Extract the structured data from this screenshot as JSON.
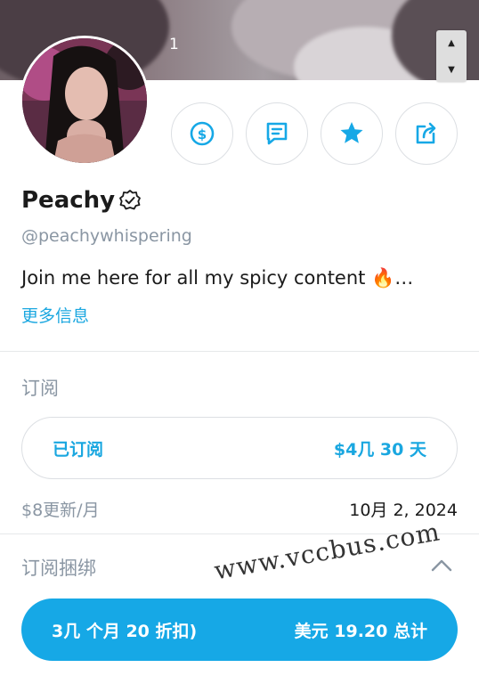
{
  "cover": {
    "counter": "1"
  },
  "actions": [
    {
      "icon": "dollar-icon"
    },
    {
      "icon": "message-icon"
    },
    {
      "icon": "star-icon"
    },
    {
      "icon": "share-icon"
    }
  ],
  "profile": {
    "name": "Peachy",
    "handle": "@peachywhispering",
    "bio": "Join me here for all my spicy content 🔥…",
    "more_label": "更多信息"
  },
  "subscription": {
    "title": "订阅",
    "status": "已订阅",
    "price": "$4几 30 天",
    "renew": "$8更新/月",
    "date": "10月 2, 2024"
  },
  "bundles": {
    "title": "订阅捆绑",
    "left": "3几 个月 20 折扣)",
    "right": "美元 19.20 总计"
  },
  "watermark": "www.vccbus.com",
  "colors": {
    "accent": "#16a8e6",
    "muted": "#8a96a3"
  }
}
